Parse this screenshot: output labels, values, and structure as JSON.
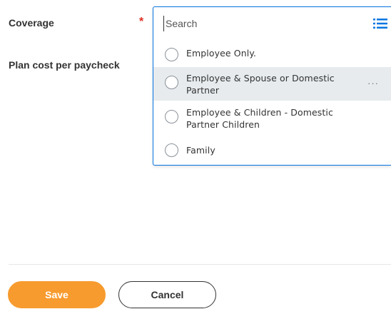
{
  "form": {
    "coverage_label": "Coverage",
    "required_marker": "*",
    "plan_cost_label": "Plan cost per paycheck"
  },
  "dropdown": {
    "search_placeholder": "Search",
    "search_value": "",
    "list_icon": "list-icon",
    "more_icon_label": "···",
    "options": [
      {
        "label": "Employee Only."
      },
      {
        "label": "Employee & Spouse or Domestic Partner"
      },
      {
        "label": "Employee & Children - Domestic Partner Children"
      },
      {
        "label": "Family"
      }
    ]
  },
  "footer": {
    "save_label": "Save",
    "cancel_label": "Cancel"
  },
  "colors": {
    "accent_blue": "#0875e1",
    "save_orange": "#f79b2e",
    "required_red": "#de2e21",
    "hover_gray": "#e7ebee"
  }
}
